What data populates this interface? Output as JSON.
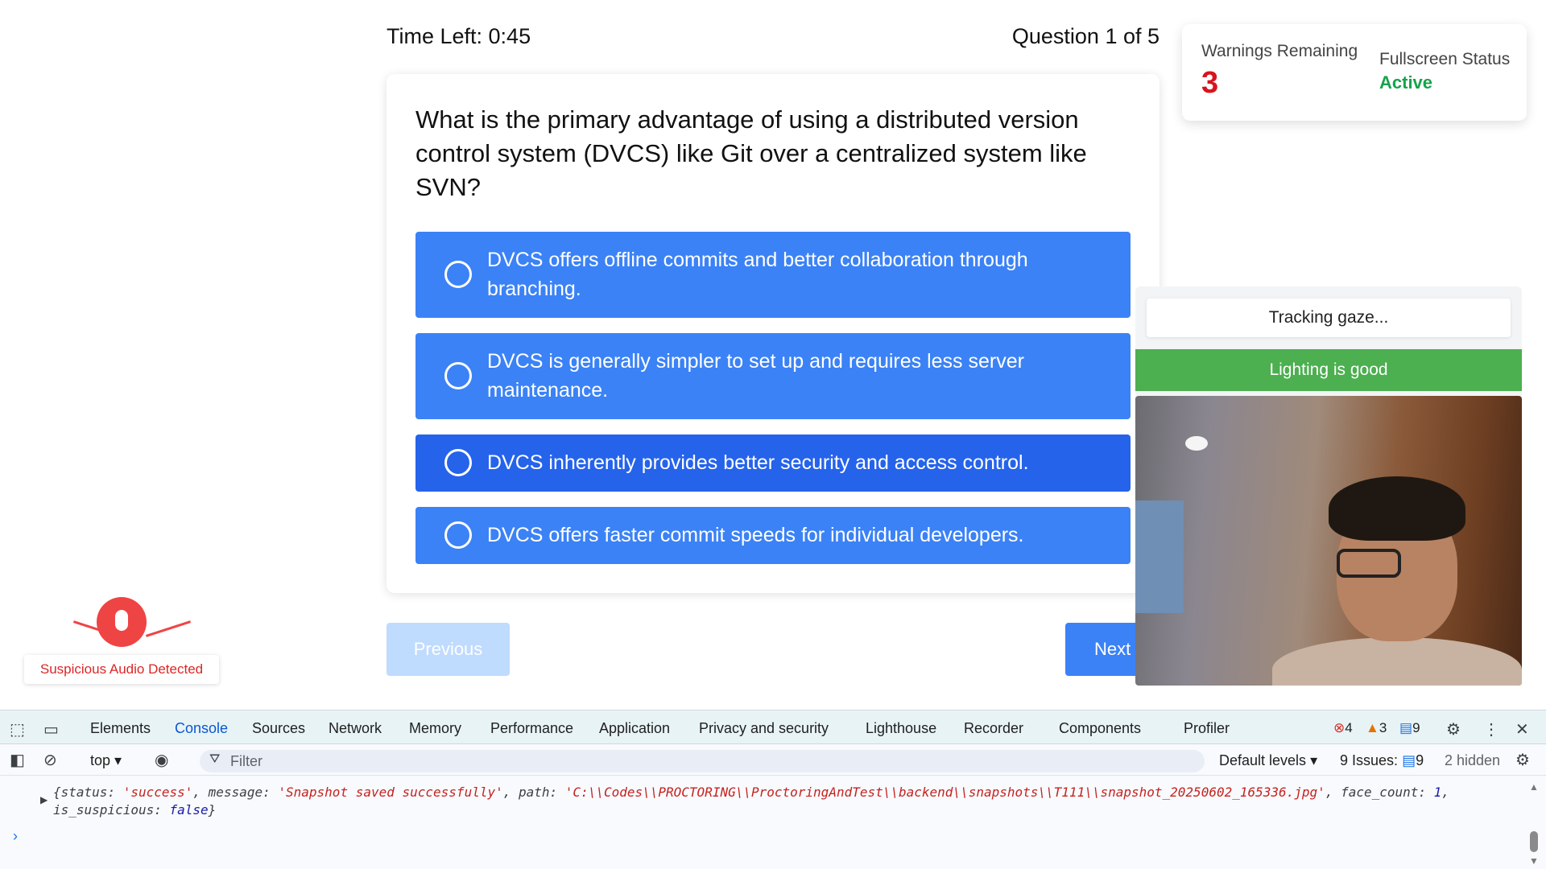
{
  "quiz": {
    "timer": "Time Left: 0:45",
    "question_count": "Question 1 of 5",
    "question": "What is the primary advantage of using a distributed version control system (DVCS) like Git over a centralized system like SVN?",
    "options": [
      "DVCS offers offline commits and better collaboration through branching.",
      "DVCS is generally simpler to set up and requires less server maintenance.",
      "DVCS inherently provides better security and access control.",
      "DVCS offers faster commit speeds for individual developers."
    ],
    "prev_label": "Previous",
    "next_label": "Next"
  },
  "status": {
    "warnings_label": "Warnings Remaining",
    "warnings_value": "3",
    "fullscreen_label": "Fullscreen Status",
    "fullscreen_value": "Active"
  },
  "proctor": {
    "gaze": "Tracking gaze...",
    "lighting": "Lighting is good",
    "audio_alert": "Suspicious Audio Detected"
  },
  "devtools": {
    "tabs": [
      "Elements",
      "Console",
      "Sources",
      "Network",
      "Memory",
      "Performance",
      "Application",
      "Privacy and security",
      "Lighthouse",
      "Recorder",
      "Components",
      "Profiler"
    ],
    "active_tab": "Console",
    "errors": "4",
    "warnings": "3",
    "messages": "9",
    "context": "top",
    "filter_placeholder": "Filter",
    "levels": "Default levels",
    "issues_label": "9 Issues:",
    "issues_count": "9",
    "hidden": "2 hidden",
    "log": {
      "status_key": "status: ",
      "status_val": "'success'",
      "message_key": "message: ",
      "message_val": "'Snapshot saved successfully'",
      "path_key": "path: ",
      "path_val": "'C:\\\\Codes\\\\PROCTORING\\\\ProctoringAndTest\\\\backend\\\\snapshots\\\\T111\\\\snapshot_20250602_165336.jpg'",
      "face_key": "face_count: ",
      "face_val": "1",
      "susp_key": "is_suspicious: ",
      "susp_val": "false"
    }
  }
}
